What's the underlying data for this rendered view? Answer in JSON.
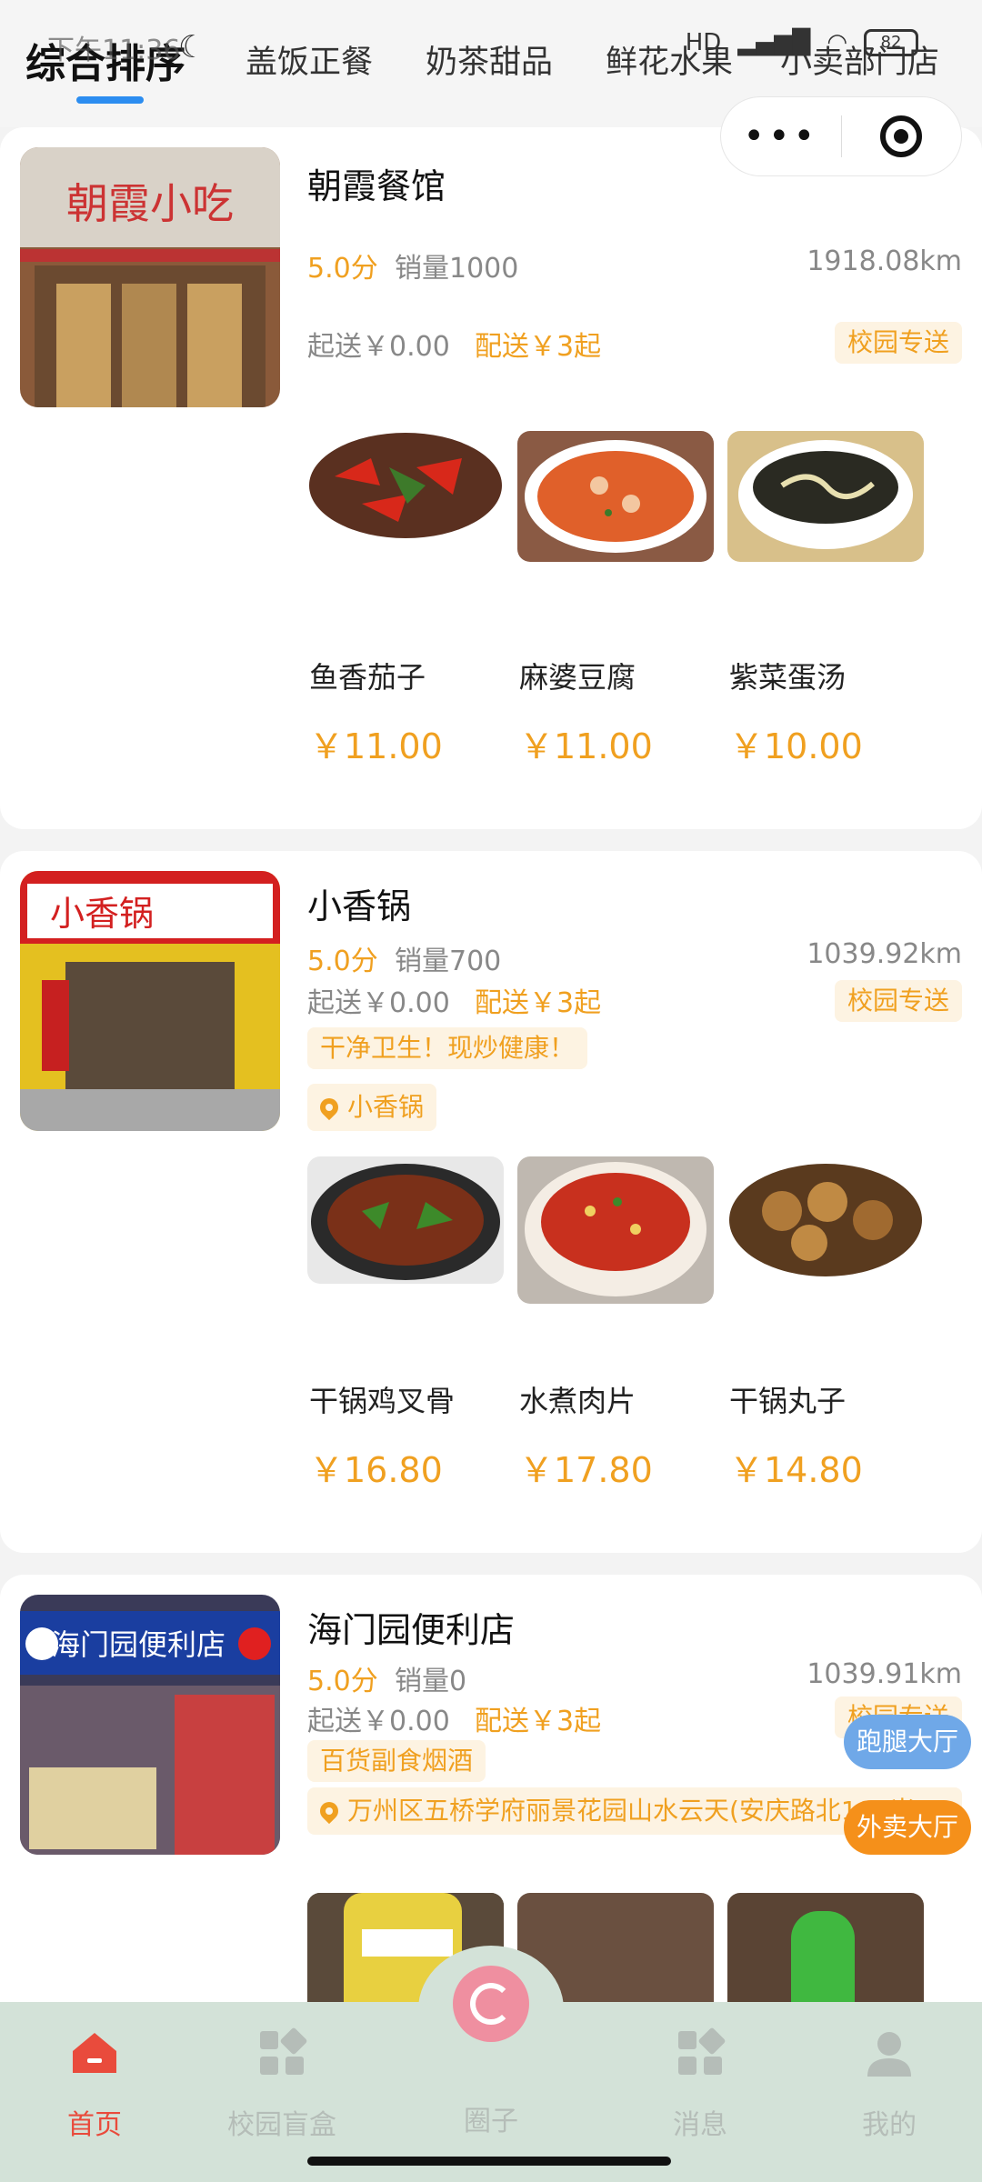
{
  "status_bar": {
    "time": "下午11:36",
    "net": "HD",
    "battery": "82"
  },
  "tabs": [
    {
      "label": "综合排序",
      "active": true
    },
    {
      "label": "盖饭正餐"
    },
    {
      "label": "奶茶甜品"
    },
    {
      "label": "鲜花水果"
    },
    {
      "label": "小卖部门店"
    }
  ],
  "capsule": {
    "more": "•••"
  },
  "stores": [
    {
      "name": "朝霞餐馆",
      "rating": "5.0分",
      "sales": "销量1000",
      "distance": "1918.08km",
      "min_order": "起送￥0.00",
      "delivery": "配送￥3起",
      "tag": "校园专送",
      "dishes": [
        {
          "name": "鱼香茄子",
          "price": "￥11.00"
        },
        {
          "name": "麻婆豆腐",
          "price": "￥11.00"
        },
        {
          "name": "紫菜蛋汤",
          "price": "￥10.00"
        }
      ]
    },
    {
      "name": "小香锅",
      "rating": "5.0分",
      "sales": "销量700",
      "distance": "1039.92km",
      "min_order": "起送￥0.00",
      "delivery": "配送￥3起",
      "tag": "校园专送",
      "slogan": "干净卫生！现炒健康！",
      "address": "小香锅",
      "dishes": [
        {
          "name": "干锅鸡叉骨",
          "price": "￥16.80"
        },
        {
          "name": "水煮肉片",
          "price": "￥17.80"
        },
        {
          "name": "干锅丸子",
          "price": "￥14.80"
        }
      ]
    },
    {
      "name": "海门园便利店",
      "rating": "5.0分",
      "sales": "销量0",
      "distance": "1039.91km",
      "min_order": "起送￥0.00",
      "delivery": "配送￥3起",
      "tag": "校园专送",
      "slogan": "百货副食烟酒",
      "address": "万州区五桥学府丽景花园山水云天(安庆路北100米)"
    }
  ],
  "floating": {
    "errand": "跑腿大厅",
    "takeout": "外卖大厅"
  },
  "nav": [
    {
      "label": "首页",
      "active": true
    },
    {
      "label": "校园盲盒"
    },
    {
      "label": "圈子"
    },
    {
      "label": "消息"
    },
    {
      "label": "我的"
    }
  ],
  "colors": {
    "accent": "#f0a020",
    "nav_active": "#e94b3c",
    "tab_underline": "#2c8df0"
  }
}
